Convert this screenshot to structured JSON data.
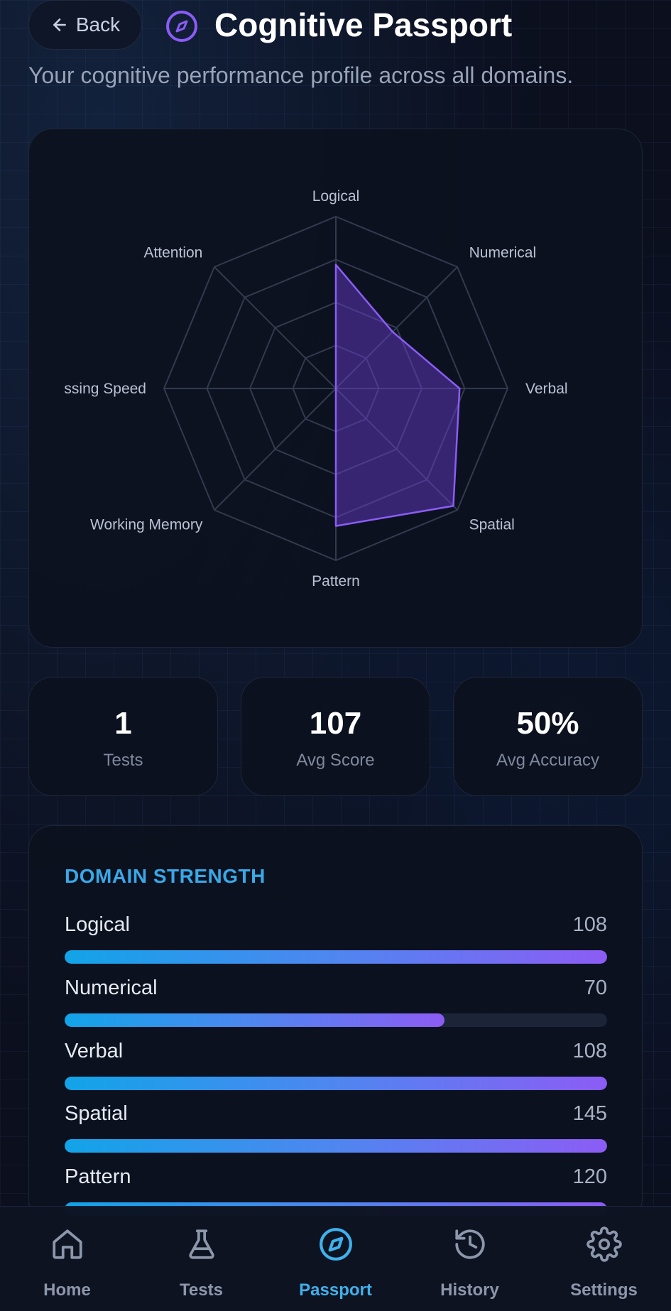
{
  "header": {
    "back_label": "Back",
    "title": "Cognitive Passport",
    "subtitle": "Your cognitive performance profile across all domains."
  },
  "chart_data": {
    "type": "radar",
    "axes": [
      "Logical",
      "Numerical",
      "Verbal",
      "Spatial",
      "Pattern",
      "Working Memory",
      "Processing Speed",
      "Attention"
    ],
    "visible_axis_labels": [
      "Logical",
      "Numerical",
      "Verbal",
      "Spatial",
      "Pattern",
      "Working Memory",
      "ssing Speed",
      "Attention"
    ],
    "values": [
      108,
      70,
      108,
      145,
      120,
      0,
      0,
      0
    ],
    "rmax": 150,
    "rings": 4,
    "grid": true,
    "colors": {
      "fill": "#6d3fd8",
      "stroke": "#8b5cf6",
      "grid": "#323a4e"
    }
  },
  "stats": [
    {
      "value": "1",
      "label": "Tests"
    },
    {
      "value": "107",
      "label": "Avg Score"
    },
    {
      "value": "50%",
      "label": "Avg Accuracy"
    }
  ],
  "domain_strength": {
    "heading": "DOMAIN STRENGTH",
    "max": 150,
    "items": [
      {
        "name": "Logical",
        "score": "108",
        "fill_fraction": 1.0
      },
      {
        "name": "Numerical",
        "score": "70",
        "fill_fraction": 0.7
      },
      {
        "name": "Verbal",
        "score": "108",
        "fill_fraction": 1.0
      },
      {
        "name": "Spatial",
        "score": "145",
        "fill_fraction": 1.0
      },
      {
        "name": "Pattern",
        "score": "120",
        "fill_fraction": 1.0
      }
    ]
  },
  "nav": [
    {
      "label": "Home",
      "icon": "home-icon"
    },
    {
      "label": "Tests",
      "icon": "flask-icon"
    },
    {
      "label": "Passport",
      "icon": "compass-icon",
      "active": true
    },
    {
      "label": "History",
      "icon": "history-icon"
    },
    {
      "label": "Settings",
      "icon": "gear-icon"
    }
  ],
  "colors": {
    "accent": "#3fb1ec",
    "purple": "#8b5cf6",
    "background": "#0b0f1e"
  }
}
